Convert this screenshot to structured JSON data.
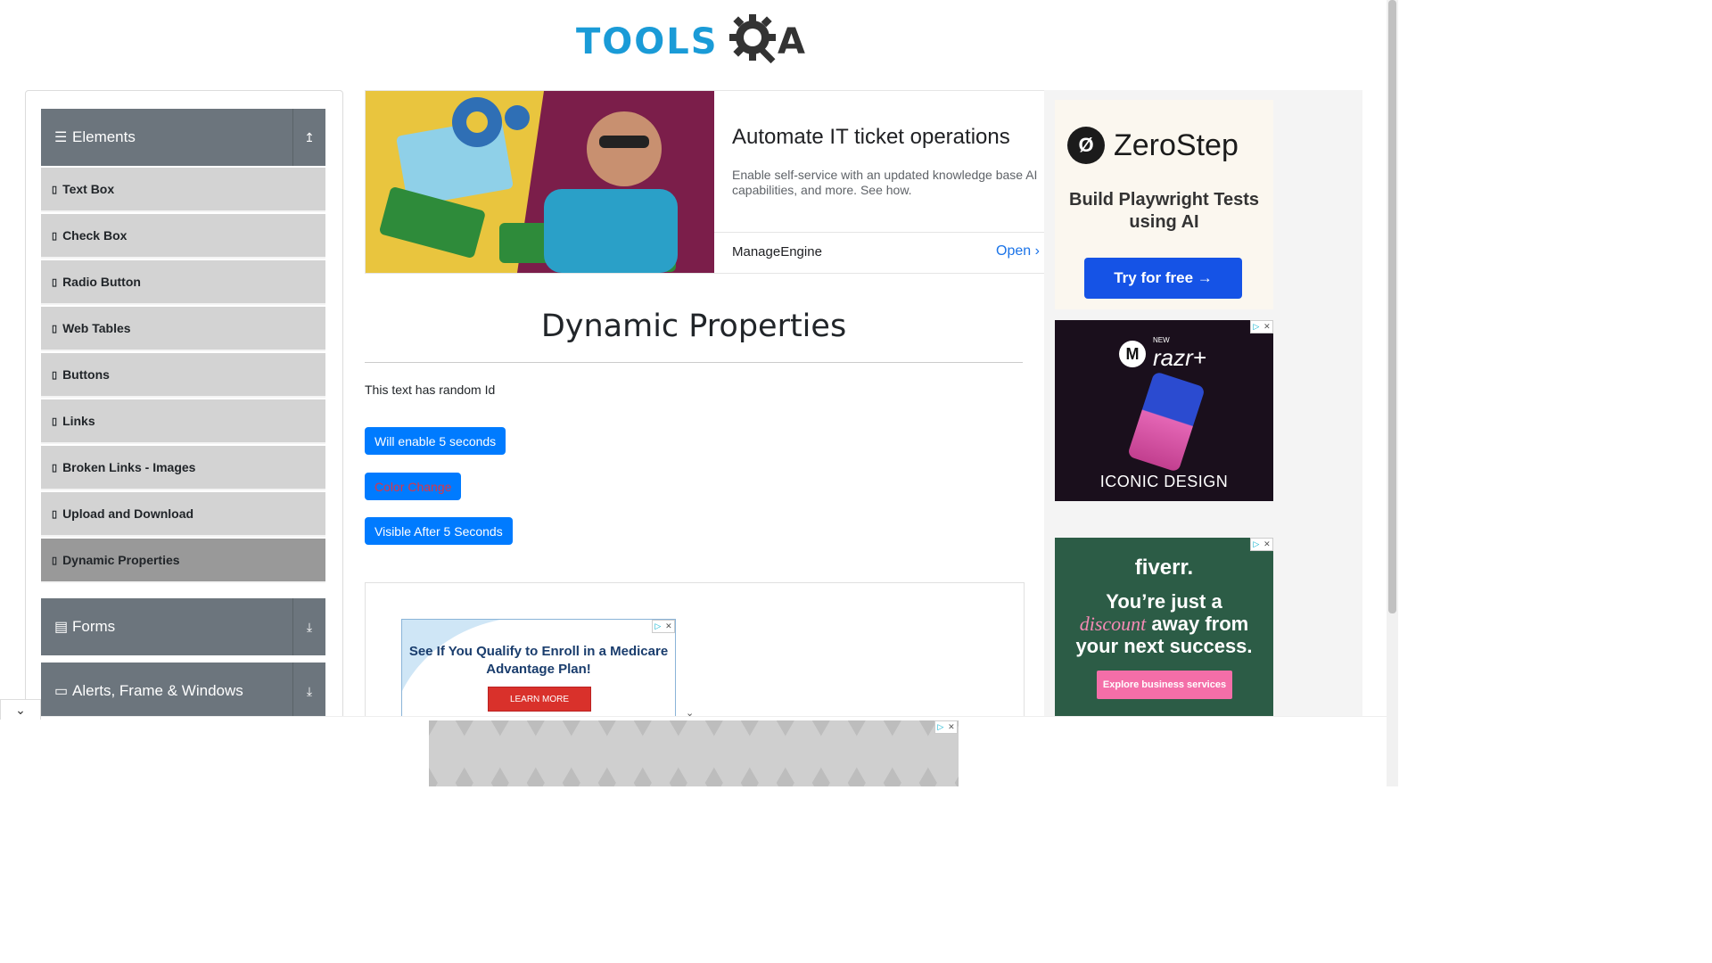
{
  "header": {
    "logo_text": "TOOLS",
    "logo_text_end": "A"
  },
  "sidebar": {
    "groups": [
      {
        "title": "Elements",
        "icon": "list-icon",
        "toggle": "↥"
      },
      {
        "title": "Forms",
        "icon": "document-icon",
        "toggle": "⤓"
      },
      {
        "title": "Alerts, Frame & Windows",
        "icon": "window-icon",
        "toggle": "⤓"
      }
    ],
    "items": [
      "Text Box",
      "Check Box",
      "Radio Button",
      "Web Tables",
      "Buttons",
      "Links",
      "Broken Links - Images",
      "Upload and Download",
      "Dynamic Properties"
    ],
    "active_item": "Dynamic Properties"
  },
  "top_ad": {
    "title": "Automate IT ticket operations",
    "description": "Enable self-service with an updated knowledge base AI capabilities, and more. See how.",
    "brand": "ManageEngine",
    "cta": "Open ›"
  },
  "main": {
    "title": "Dynamic Properties",
    "random_text": "This text has random Id",
    "buttons": {
      "enable": "Will enable 5 seconds",
      "color_change": "Color Change",
      "visible_after": "Visible After 5 Seconds"
    }
  },
  "inner_ad": {
    "text": "See If You Qualify to Enroll in a Medicare Advantage Plan!",
    "cta": "LEARN MORE"
  },
  "right_ads": {
    "zerostep": {
      "brand": "ZeroStep",
      "tagline": "Build Playwright Tests using AI",
      "cta": "Try for free →"
    },
    "razr": {
      "new_label": "NEW",
      "brand": "razr+",
      "tagline": "ICONIC DESIGN"
    },
    "fiverr": {
      "brand": "fiverr.",
      "line1": "You’re just a",
      "discount": "discount",
      "line2": "away from",
      "line3": "your next success.",
      "cta": "Explore business services"
    }
  },
  "colors": {
    "primary": "#007bff",
    "sidebar_header": "#6c757d",
    "menu_item": "#d3d3d3",
    "menu_active": "#999999",
    "logo_blue": "#1a9bd7"
  }
}
